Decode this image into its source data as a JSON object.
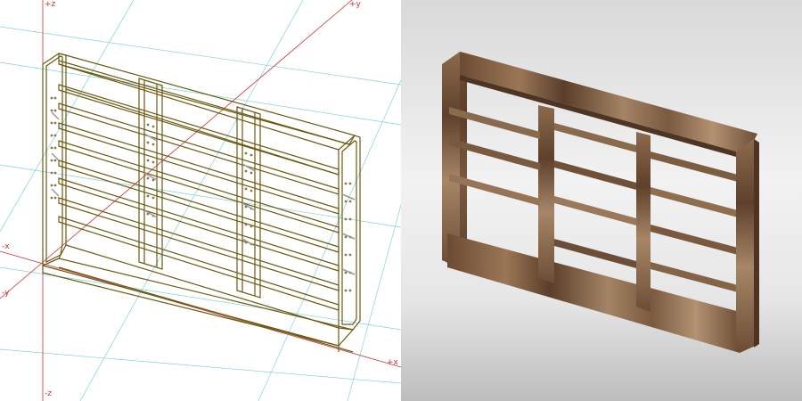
{
  "wireframe_view": {
    "axis_labels": {
      "pos_z": "+z",
      "pos_y": "+y",
      "neg_x": "-x",
      "neg_y": "-y",
      "pos_x": "+x",
      "neg_z": "-z"
    }
  },
  "render_view": {}
}
